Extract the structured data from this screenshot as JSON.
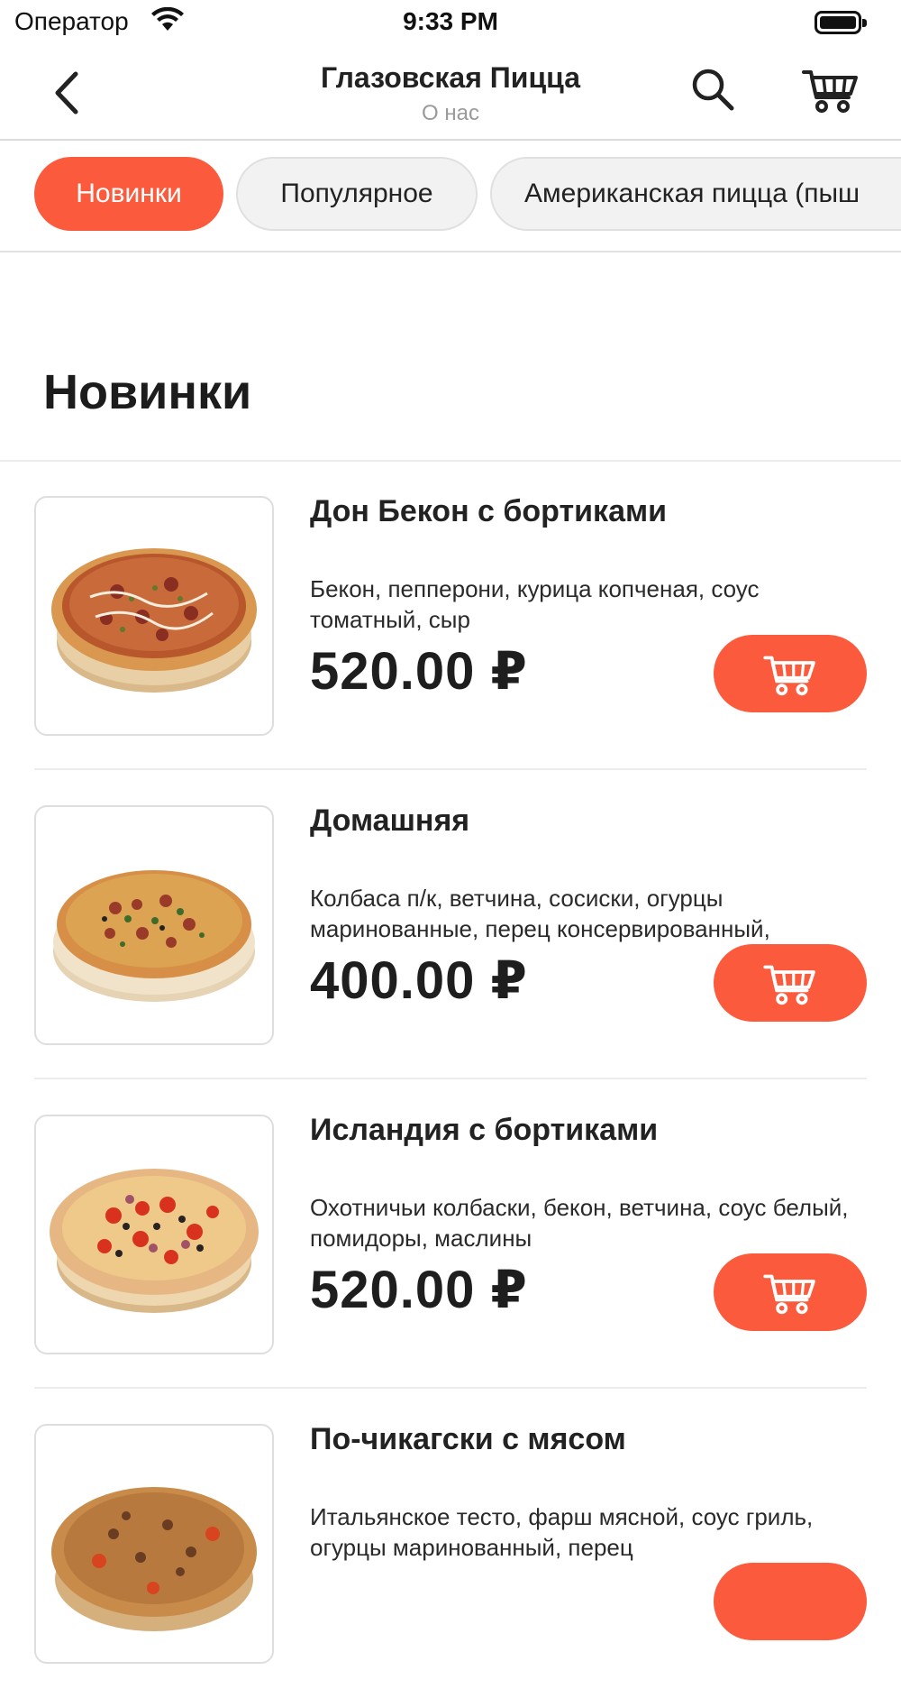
{
  "status_bar": {
    "carrier": "Оператор",
    "time": "9:33 PM"
  },
  "navbar": {
    "title": "Глазовская Пицца",
    "subtitle": "О нас"
  },
  "categories": [
    {
      "label": "Новинки",
      "active": true
    },
    {
      "label": "Популярное",
      "active": false
    },
    {
      "label": "Американская пицца (пыш",
      "active": false
    }
  ],
  "section_title": "Новинки",
  "products": [
    {
      "name": "Дон Бекон с бортиками",
      "description": "Бекон, пепперони, курица копченая, соус томатный, сыр",
      "price": "520.00 ₽"
    },
    {
      "name": "Домашняя",
      "description": "Колбаса п/к, ветчина, сосиски, огурцы маринованные, перец консервированный,",
      "price": "400.00 ₽"
    },
    {
      "name": "Исландия с бортиками",
      "description": "Охотничьи  колбаски, бекон, ветчина, соус белый, помидоры, маслины",
      "price": "520.00 ₽"
    },
    {
      "name": "По-чикагски с мясом",
      "description": "Итальянское тесто, фарш мясной, соус гриль, огурцы маринованный, перец",
      "price": ""
    }
  ],
  "colors": {
    "accent": "#fb5a3c",
    "chip_inactive_bg": "#f2f2f2",
    "subtitle_gray": "#9a9a9a"
  },
  "icons": {
    "back": "chevron-left-icon",
    "search": "search-icon",
    "cart": "cart-icon"
  }
}
